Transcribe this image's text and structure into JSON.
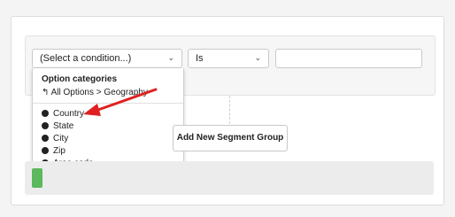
{
  "condition_select": {
    "value": "(Select a condition...)",
    "icon": "chevron-down-icon"
  },
  "operator_select": {
    "value": "Is",
    "icon": "chevron-down-icon"
  },
  "value_input": {
    "value": ""
  },
  "dropdown": {
    "header": "Option categories",
    "back_label": "All Options > Geography",
    "back_icon": "back-arrow-icon",
    "items": [
      {
        "label": "Country",
        "icon": "globe-icon"
      },
      {
        "label": "State",
        "icon": "globe-icon"
      },
      {
        "label": "City",
        "icon": "globe-icon"
      },
      {
        "label": "Zip",
        "icon": "globe-icon"
      },
      {
        "label": "Area code",
        "icon": "globe-icon"
      }
    ]
  },
  "segment_group_button": {
    "label": "Add New Segment Group"
  },
  "colors": {
    "annotation_arrow": "#e02020",
    "accent_green": "#5cb85c"
  }
}
